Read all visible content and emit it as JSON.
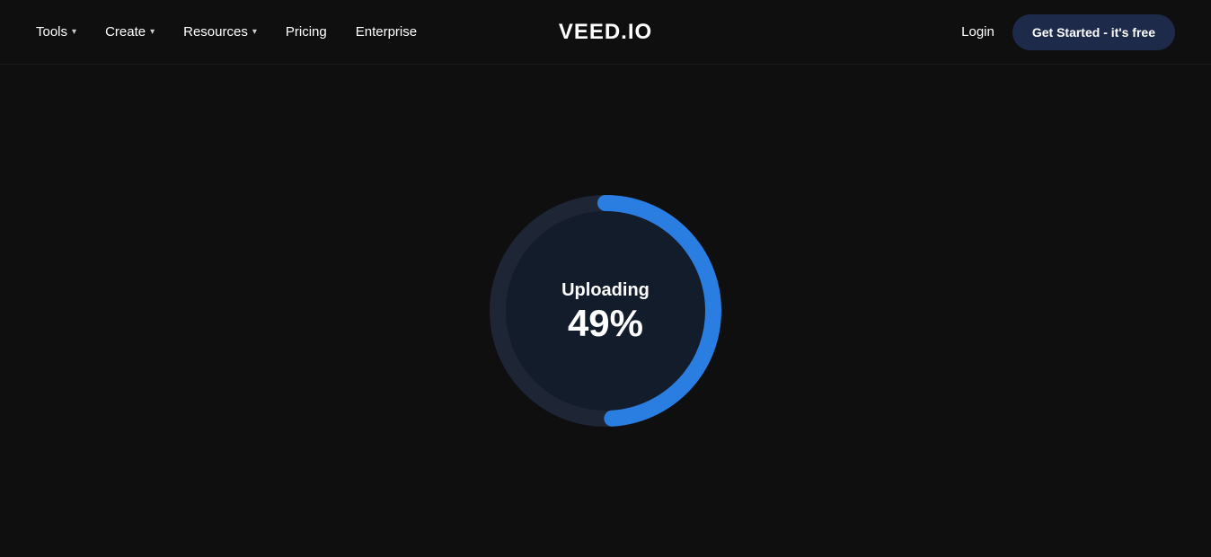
{
  "navbar": {
    "logo": "VEED.IO",
    "nav_items": [
      {
        "label": "Tools",
        "has_chevron": true
      },
      {
        "label": "Create",
        "has_chevron": true
      },
      {
        "label": "Resources",
        "has_chevron": true
      },
      {
        "label": "Pricing",
        "has_chevron": false
      },
      {
        "label": "Enterprise",
        "has_chevron": false
      }
    ],
    "login_label": "Login",
    "get_started_label": "Get Started - it's free"
  },
  "main": {
    "uploading_label": "Uploading",
    "percent_label": "49%",
    "progress_value": 49,
    "colors": {
      "track": "#1e2535",
      "bar": "#2a7de1",
      "bg": "#131c2b"
    }
  }
}
